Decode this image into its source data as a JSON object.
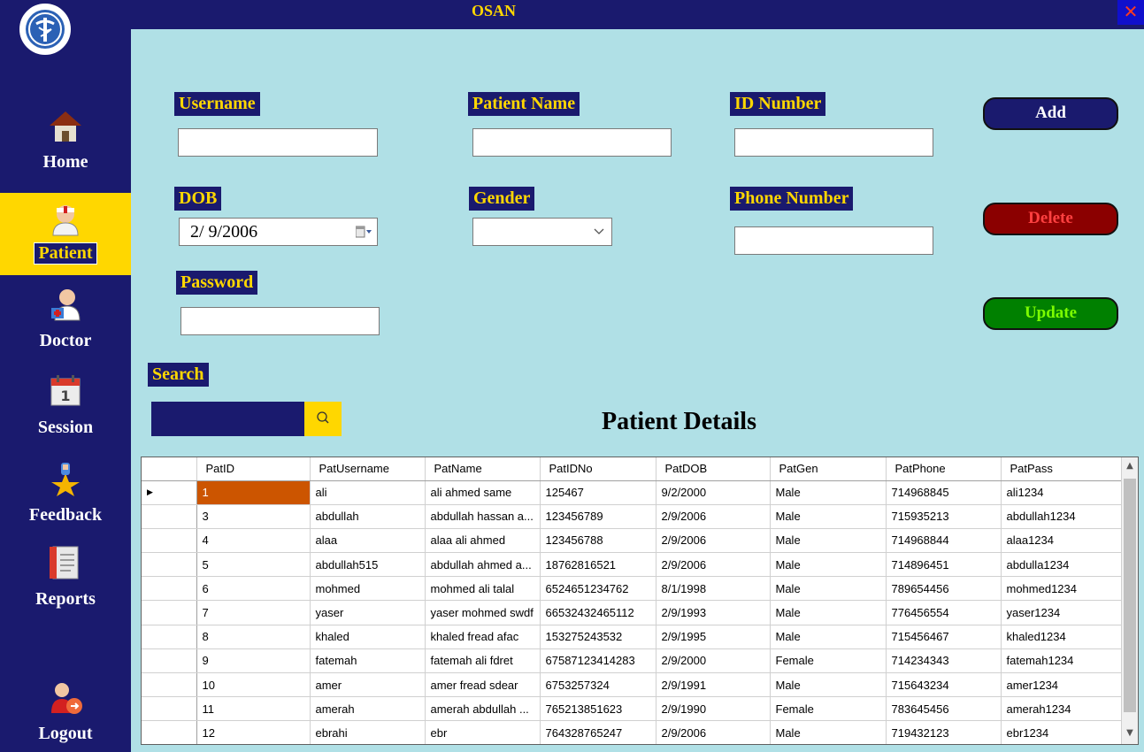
{
  "window": {
    "title": "OSAN",
    "close_label": "✕"
  },
  "sidebar": {
    "items": [
      {
        "label": "Home",
        "icon": "home-icon"
      },
      {
        "label": "Patient",
        "icon": "patient-icon",
        "active": true
      },
      {
        "label": "Doctor",
        "icon": "doctor-icon"
      },
      {
        "label": "Session",
        "icon": "calendar-icon"
      },
      {
        "label": "Feedback",
        "icon": "feedback-icon"
      },
      {
        "label": "Reports",
        "icon": "reports-icon"
      },
      {
        "label": "Logout",
        "icon": "logout-icon"
      }
    ]
  },
  "form": {
    "username_label": "Username",
    "username_value": "",
    "patient_name_label": "Patient Name",
    "patient_name_value": "",
    "id_number_label": "ID Number",
    "id_number_value": "",
    "dob_label": "DOB",
    "dob_value": "2/ 9/2006",
    "gender_label": "Gender",
    "gender_value": "",
    "phone_label": "Phone Number",
    "phone_value": "",
    "password_label": "Password",
    "password_value": ""
  },
  "buttons": {
    "add": "Add",
    "delete": "Delete",
    "update": "Update"
  },
  "search": {
    "label": "Search",
    "value": ""
  },
  "table": {
    "title": "Patient Details",
    "columns": [
      "PatID",
      "PatUsername",
      "PatName",
      "PatIDNo",
      "PatDOB",
      "PatGen",
      "PatPhone",
      "PatPass"
    ],
    "rows": [
      [
        "1",
        "ali",
        "ali ahmed same",
        "125467",
        "9/2/2000",
        "Male",
        "714968845",
        "ali1234"
      ],
      [
        "3",
        "abdullah",
        "abdullah hassan a...",
        "123456789",
        "2/9/2006",
        "Male",
        "715935213",
        "abdullah1234"
      ],
      [
        "4",
        "alaa",
        "alaa ali ahmed",
        "123456788",
        "2/9/2006",
        "Male",
        "714968844",
        "alaa1234"
      ],
      [
        "5",
        "abdullah515",
        "abdullah ahmed a...",
        "18762816521",
        "2/9/2006",
        "Male",
        "714896451",
        "abdulla1234"
      ],
      [
        "6",
        "mohmed",
        "mohmed ali talal",
        "6524651234762",
        "8/1/1998",
        "Male",
        "789654456",
        "mohmed1234"
      ],
      [
        "7",
        "yaser",
        "yaser mohmed swdf",
        "66532432465112",
        "2/9/1993",
        "Male",
        "776456554",
        "yaser1234"
      ],
      [
        "8",
        "khaled",
        "khaled fread afac",
        "153275243532",
        "2/9/1995",
        "Male",
        "715456467",
        "khaled1234"
      ],
      [
        "9",
        "fatemah",
        "fatemah ali fdret",
        "67587123414283",
        "2/9/2000",
        "Female",
        "714234343",
        "fatemah1234"
      ],
      [
        "10",
        "amer",
        "amer fread sdear",
        "6753257324",
        "2/9/1991",
        "Male",
        "715643234",
        "amer1234"
      ],
      [
        "11",
        "amerah",
        "amerah abdullah ...",
        "765213851623",
        "2/9/1990",
        "Female",
        "783645456",
        "amerah1234"
      ],
      [
        "12",
        "ebrahi",
        "ebr",
        "764328765247",
        "2/9/2006",
        "Male",
        "719432123",
        "ebr1234"
      ]
    ],
    "selected_row_marker": "▶"
  }
}
